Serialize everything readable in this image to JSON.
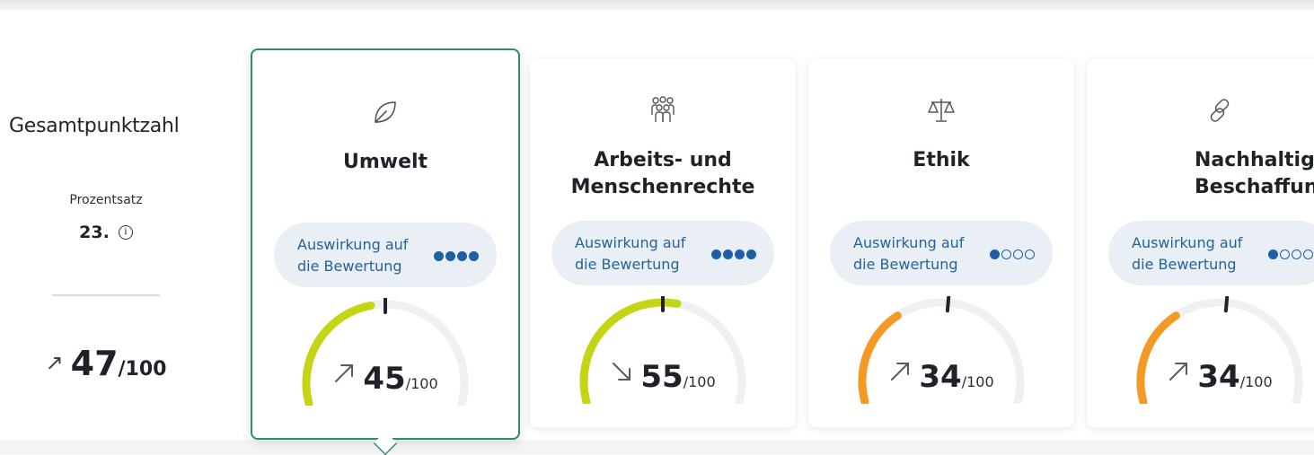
{
  "overall": {
    "title": "Gesamtpunktzahl",
    "percent_label": "Prozentsatz",
    "rank": "23.",
    "info_icon": "info-icon",
    "trend": "up",
    "score": "47",
    "max": "/100"
  },
  "colors": {
    "green_gauge": "#c4d515",
    "orange_gauge": "#f39a24",
    "track": "#eef0f2",
    "selected_border": "#2e8b6e",
    "impact_text": "#23639d"
  },
  "cards": [
    {
      "title": "Umwelt",
      "icon": "leaf-icon",
      "impact_label": "Auswirkung auf die Bewertung",
      "impact_level": 4,
      "impact_max": 4,
      "trend": "up",
      "score": "45",
      "max": "/100",
      "score_value": 45,
      "selected": true
    },
    {
      "title": "Arbeits- und Menschenrechte",
      "icon": "people-icon",
      "impact_label": "Auswirkung auf die Bewertung",
      "impact_level": 4,
      "impact_max": 4,
      "trend": "down",
      "score": "55",
      "max": "/100",
      "score_value": 55,
      "selected": false
    },
    {
      "title": "Ethik",
      "icon": "scales-icon",
      "impact_label": "Auswirkung auf die Bewertung",
      "impact_level": 1,
      "impact_max": 4,
      "trend": "up",
      "score": "34",
      "max": "/100",
      "score_value": 34,
      "selected": false
    },
    {
      "title": "Nachhaltige Beschaffung",
      "icon": "chain-link-icon",
      "impact_label": "Auswirkung auf die Bewertung",
      "impact_level": 1,
      "impact_max": 4,
      "trend": "up",
      "score": "34",
      "max": "/100",
      "score_value": 34,
      "selected": false
    }
  ]
}
